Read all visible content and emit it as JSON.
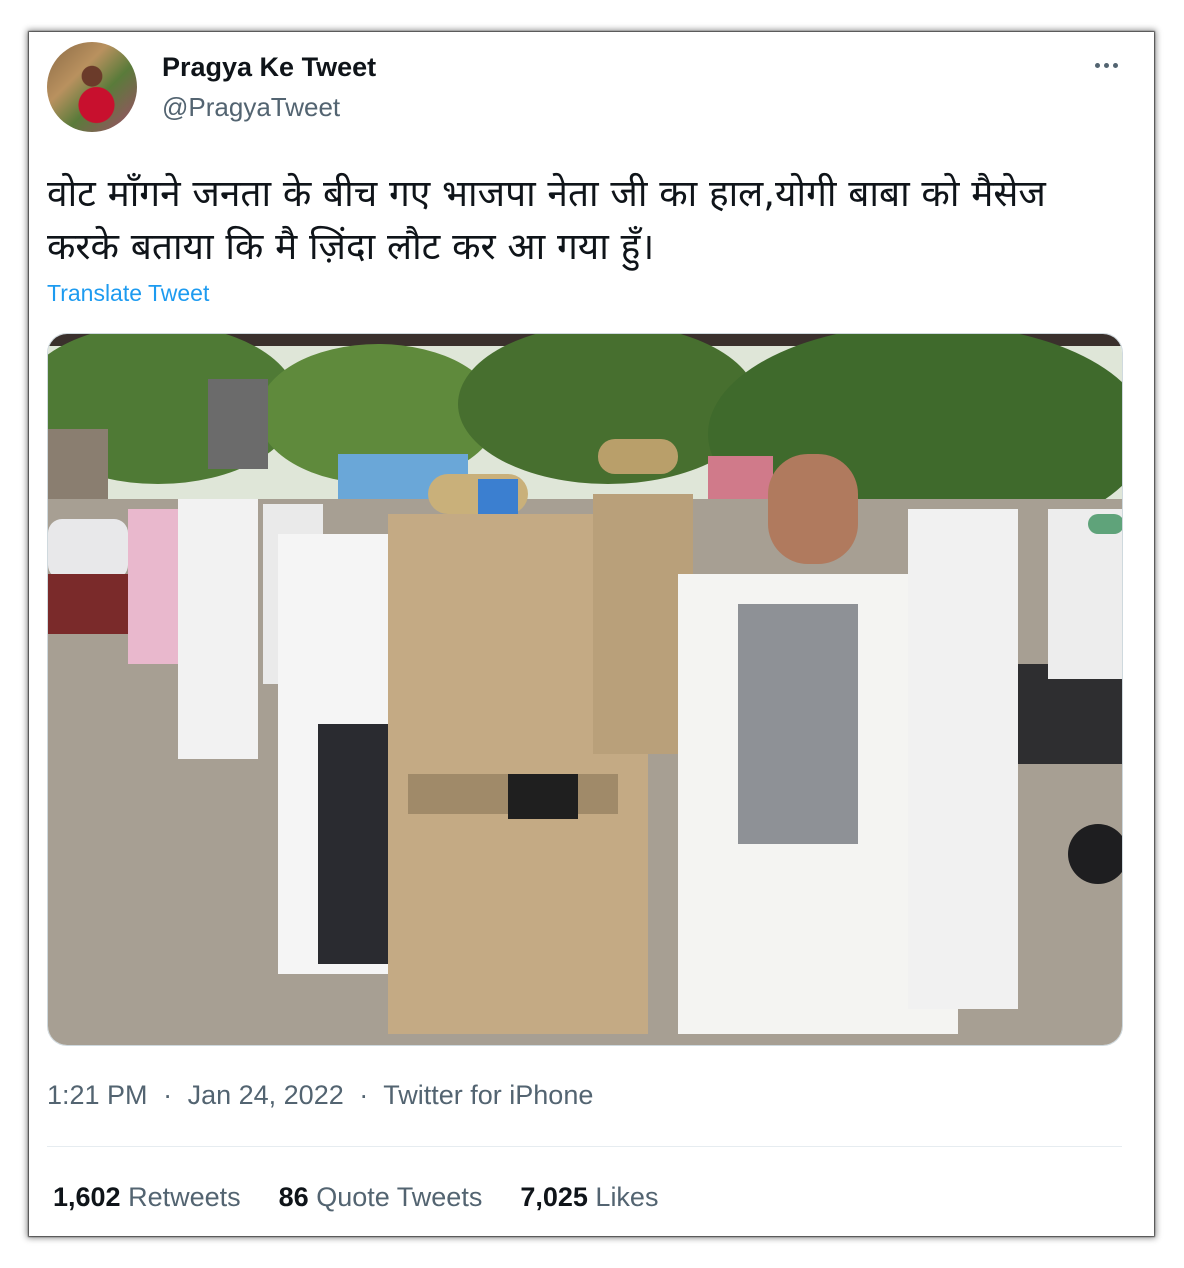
{
  "author": {
    "display_name": "Pragya Ke Tweet",
    "handle": "@PragyaTweet",
    "avatar_icon": "profile-avatar"
  },
  "more_icon": "more-options-icon",
  "tweet": {
    "text": "वोट माँगने जनता के बीच गए भाजपा नेता जी का हाल,योगी बाबा को मैसेज करके बताया कि मै ज़िंदा लौट कर आ गया हुँ।",
    "translate_label": "Translate Tweet"
  },
  "meta": {
    "time": "1:21 PM",
    "date": "Jan 24, 2022",
    "source": "Twitter for iPhone",
    "separator": "·"
  },
  "stats": {
    "retweets_count": "1,602",
    "retweets_label": "Retweets",
    "quotes_count": "86",
    "quotes_label": "Quote Tweets",
    "likes_count": "7,025",
    "likes_label": "Likes"
  },
  "colors": {
    "link": "#1d9bf0",
    "secondary_text": "#536471",
    "primary_text": "#0f1419"
  }
}
